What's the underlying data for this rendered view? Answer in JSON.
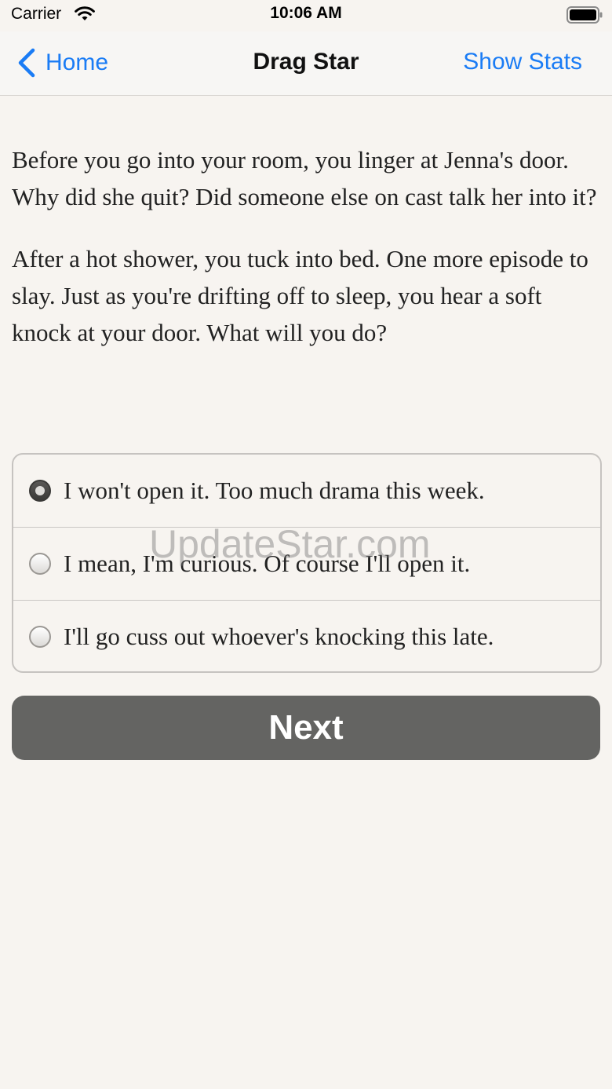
{
  "status_bar": {
    "carrier": "Carrier",
    "time": "10:06 AM",
    "icons": [
      "wifi-icon",
      "battery-icon"
    ]
  },
  "nav": {
    "back_label": "Home",
    "title": "Drag Star",
    "right_label": "Show Stats",
    "accent_color": "#1a7cf5"
  },
  "story": {
    "paragraphs": [
      "Before you go into your room, you linger at Jenna's door. Why did she quit? Did someone else on cast talk her into it?",
      "After a hot shower, you tuck into bed. One more episode to slay. Just as you're drifting off to sleep, you hear a soft knock at your door. What will you do?"
    ]
  },
  "choices": [
    {
      "label": "I won't open it. Too much drama this week.",
      "selected": true
    },
    {
      "label": "I mean, I'm curious. Of course I'll open it.",
      "selected": false
    },
    {
      "label": "I'll go cuss out whoever's knocking this late.",
      "selected": false
    }
  ],
  "next_button": {
    "label": "Next",
    "color": "#646462"
  },
  "watermark": "UpdateStar.com"
}
